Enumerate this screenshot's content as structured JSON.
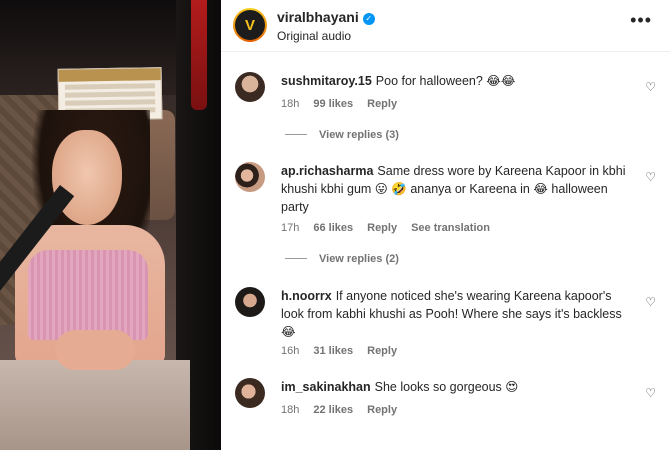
{
  "post": {
    "username": "viralbhayani",
    "audio": "Original audio",
    "logo_letter": "V"
  },
  "comments": [
    {
      "username": "sushmitaroy.15",
      "text": "Poo for halloween? 😂😂",
      "time": "18h",
      "likes": "99 likes",
      "reply": "Reply",
      "view_replies": "View replies (3)"
    },
    {
      "username": "ap.richasharma",
      "text": "Same dress wore by Kareena Kapoor in kbhi khushi kbhi gum 😛 🤣 ananya or Kareena in 😂 halloween party",
      "time": "17h",
      "likes": "66 likes",
      "reply": "Reply",
      "see_translation": "See translation",
      "view_replies": "View replies (2)"
    },
    {
      "username": "h.noorrx",
      "text": "If anyone noticed she's wearing Kareena kapoor's look from kabhi khushi as Pooh! Where she says it's backless 😂",
      "time": "16h",
      "likes": "31 likes",
      "reply": "Reply"
    },
    {
      "username": "im_sakinakhan",
      "text": "She looks so gorgeous 😍",
      "time": "18h",
      "likes": "22 likes",
      "reply": "Reply"
    }
  ],
  "icons": {
    "heart": "heart-outline",
    "more": "more-horizontal",
    "verified": "verified-badge"
  },
  "colors": {
    "verified": "#0095f6",
    "muted": "#737373",
    "text": "#262626"
  }
}
